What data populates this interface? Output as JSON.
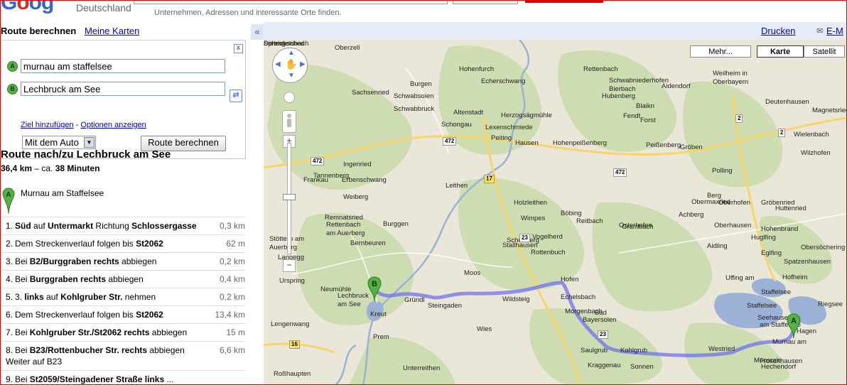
{
  "header": {
    "country": "Deutschland",
    "search_hint": "Unternehmen, Adressen und interessante Orte finden."
  },
  "sidebar": {
    "tab_active": "Route berechnen",
    "tab_link": "Meine Karten",
    "collapse": "«",
    "close": "x",
    "from_marker": "A",
    "to_marker": "B",
    "from_value": "murnau am staffelsee",
    "to_value": "Lechbruck am See",
    "add_dest": "Ziel hinzufügen",
    "separator": " - ",
    "options": "Optionen anzeigen",
    "mode": "Mit dem Auto",
    "route_button": "Route berechnen",
    "route_title": "Route nach/zu Lechbruck am See",
    "route_distance": "36,4 km",
    "route_dash": " – ca. ",
    "route_time": "38 Minuten",
    "start_name": "Murnau am Staffelsee"
  },
  "steps": [
    {
      "num": "1.",
      "html": "<b>Süd</b> auf <b>Untermarkt</b> Richtung <b>Schlossergasse</b>",
      "dist": "0,3 km"
    },
    {
      "num": "2.",
      "html": "Dem Streckenverlauf folgen bis <b>St2062</b>",
      "dist": "62 m"
    },
    {
      "num": "3.",
      "html": "Bei <b>B2/Burggraben rechts</b> abbiegen",
      "dist": "0,2 km"
    },
    {
      "num": "4.",
      "html": "Bei <b>Burggraben rechts</b> abbiegen",
      "dist": "0,4 km"
    },
    {
      "num": "5.",
      "html": "3. <b>links</b> auf <b>Kohlgruber Str.</b> nehmen",
      "dist": "0,2 km"
    },
    {
      "num": "6.",
      "html": "Dem Streckenverlauf folgen bis <b>St2062</b>",
      "dist": "13,4 km"
    },
    {
      "num": "7.",
      "html": "Bei <b>Kohlgruber Str./St2062 rechts</b> abbiegen",
      "dist": "15 m"
    },
    {
      "num": "8.",
      "html": "Bei <b>B23/Rottenbucher Str. rechts</b> abbiegen<br>Weiter auf B23",
      "dist": "6,6 km"
    },
    {
      "num": "9.",
      "html": "Bei <b>St2059/Steingadener Straße links</b> ...",
      "dist": ""
    }
  ],
  "map_toolbar": {
    "print": "Drucken",
    "email": "E-M"
  },
  "map_types": {
    "more": "Mehr...",
    "map": "Karte",
    "satellite": "Satellit"
  },
  "zoom": {
    "plus": "+",
    "minus": "−"
  },
  "map_labels": [
    "Oberzell",
    "Hohenfurch",
    "Weilheim in",
    "Oberbayern",
    "Sachsenried",
    "Schwabsoien",
    "Schwabbruck",
    "Altenstadt",
    "Schongau",
    "Peiting",
    "Hohenpeißenberg",
    "Peißenberg",
    "Polling",
    "Ingenried",
    "Erbenschwang",
    "Rettenbach",
    "am Auerberg",
    "Burggen",
    "Böbing",
    "Rottenbuch",
    "Wildsteig",
    "Steingaden",
    "Lechbruck",
    "am See",
    "Prem",
    "Bad",
    "Bayersoien",
    "Saulgrub",
    "Kohlgrub",
    "Uffing am",
    "Staffelsee",
    "Seehausen",
    "am Staffelsee",
    "Murnau am",
    "Riegsee",
    "Hagen",
    "Oberhausen",
    "Huglfing",
    "Eglfing",
    "Obersöchering",
    "Spatzenhausen",
    "Hofheim",
    "Stöttern am",
    "Auerberg",
    "Bernbeuren",
    "Roßhaupten",
    "Echelsbach",
    "Wies",
    "Morgenbach",
    "Kraggenau",
    "Sonnen",
    "Westried",
    "Unterreithen",
    "Lengenwang",
    "Deutenhausen",
    "Magnetsried",
    "Wielenbach",
    "Wilzhofen",
    "Lexenschmiede",
    "Herzogsägmühle",
    "Hausen",
    "Grambach",
    "Gröbenried",
    "Huttenried",
    "Frankau",
    "Tannenberg",
    "Remnatsried",
    "Langegg",
    "Urspring",
    "Gründl",
    "Kreut",
    "Leithen",
    "Holzleithen",
    "Wimpes",
    "Vogelherd",
    "Stallhausen",
    "Moos",
    "Schönberg",
    "Hofen",
    "Staffelsee",
    "Hechendorf",
    "Moosrain",
    "Froschhausen",
    "Aidling",
    "Achberg",
    "Obermaxried",
    "Oberhofen",
    "Berg",
    "Hohenbrand",
    "Neumühle",
    "Weiberg",
    "Echerschwang",
    "Burgen",
    "Rettenbach",
    "Schwabniederhofen",
    "Bierbach",
    "Blaikn",
    "Forst",
    "Fendt",
    "Aidendorf",
    "Hubenberg",
    "Gröben",
    "Reitbach",
    "Osterhofen",
    "Sprengelsbach",
    "Scheue",
    "Dietrichsched"
  ],
  "roads": [
    "472",
    "472",
    "472",
    "17",
    "23",
    "23",
    "16",
    "2",
    "2"
  ]
}
